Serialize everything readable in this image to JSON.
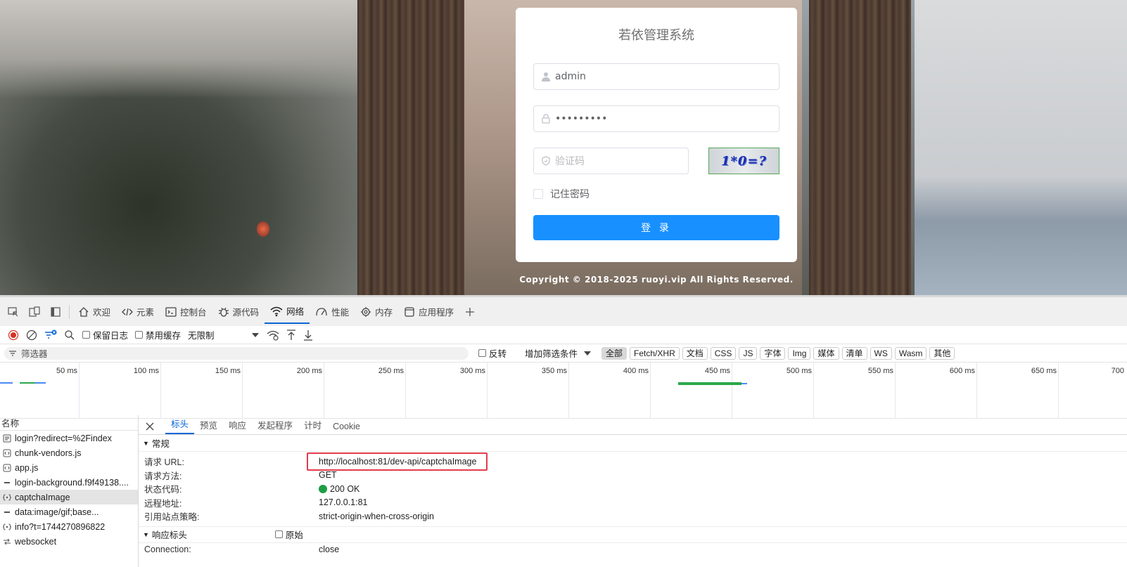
{
  "login": {
    "title": "若依管理系统",
    "username": "admin",
    "password": "•••••••••",
    "captcha_placeholder": "验证码",
    "captcha_text": "1*0=?",
    "remember_label": "记住密码",
    "login_button": "登 录",
    "copyright": "Copyright © 2018-2025 ruoyi.vip All Rights Reserved."
  },
  "devtools": {
    "tabs": [
      {
        "label": "欢迎",
        "icon": "home-icon"
      },
      {
        "label": "元素",
        "icon": "code-icon"
      },
      {
        "label": "控制台",
        "icon": "console-icon"
      },
      {
        "label": "源代码",
        "icon": "bug-icon"
      },
      {
        "label": "网络",
        "icon": "wifi-icon"
      },
      {
        "label": "性能",
        "icon": "gauge-icon"
      },
      {
        "label": "内存",
        "icon": "memory-icon"
      },
      {
        "label": "应用程序",
        "icon": "app-icon"
      }
    ],
    "toolbar": {
      "preserve_log": "保留日志",
      "disable_cache": "禁用缓存",
      "throttle": "无限制"
    },
    "filter": {
      "placeholder": "筛选器",
      "invert": "反转",
      "more_filters": "增加筛选条件",
      "types": [
        "全部",
        "Fetch/XHR",
        "文档",
        "CSS",
        "JS",
        "字体",
        "Img",
        "媒体",
        "清单",
        "WS",
        "Wasm",
        "其他"
      ],
      "active_type": "全部"
    },
    "timeline_ticks": [
      "50 ms",
      "100 ms",
      "150 ms",
      "200 ms",
      "250 ms",
      "300 ms",
      "350 ms",
      "400 ms",
      "450 ms",
      "500 ms",
      "550 ms",
      "600 ms",
      "650 ms",
      "700"
    ],
    "request_list": {
      "header": "名称",
      "items": [
        {
          "name": "login?redirect=%2Findex",
          "icon": "doc-icon"
        },
        {
          "name": "chunk-vendors.js",
          "icon": "script-icon"
        },
        {
          "name": "app.js",
          "icon": "script-icon"
        },
        {
          "name": "login-background.f9f49138....",
          "icon": "image-icon"
        },
        {
          "name": "captchaImage",
          "icon": "xhr-icon",
          "selected": true
        },
        {
          "name": "data:image/gif;base...",
          "icon": "image-icon"
        },
        {
          "name": "info?t=1744270896822",
          "icon": "xhr-icon"
        },
        {
          "name": "websocket",
          "icon": "websocket-icon"
        }
      ]
    },
    "detail": {
      "tabs": [
        "标头",
        "预览",
        "响应",
        "发起程序",
        "计时",
        "Cookie"
      ],
      "active_tab": "标头",
      "general_header": "常规",
      "general": [
        {
          "key": "请求 URL:",
          "value": "http://localhost:81/dev-api/captchaImage"
        },
        {
          "key": "请求方法:",
          "value": "GET"
        },
        {
          "key": "状态代码:",
          "value": "200 OK"
        },
        {
          "key": "远程地址:",
          "value": "127.0.0.1:81"
        },
        {
          "key": "引用站点策略:",
          "value": "strict-origin-when-cross-origin"
        }
      ],
      "response_header": "响应标头",
      "raw_label": "原始",
      "response": [
        {
          "key": "Connection:",
          "value": "close"
        }
      ]
    }
  },
  "colors": {
    "accent": "#1890ff",
    "devtools_blue": "#0a66d6",
    "status_ok": "#1e9e44",
    "highlight": "#e43c4c"
  }
}
